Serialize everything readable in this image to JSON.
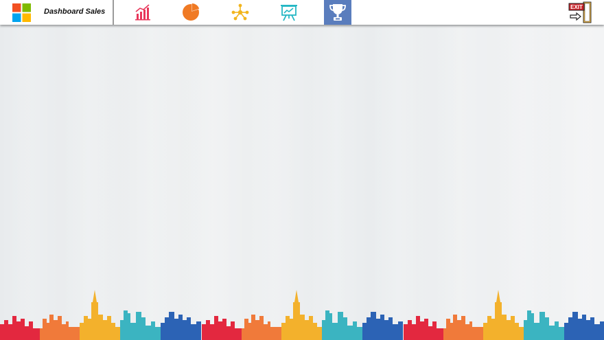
{
  "header": {
    "title": "Dashboard Sales",
    "nav": [
      {
        "icon": "bar-chart-icon",
        "color": "#e8365a"
      },
      {
        "icon": "pie-chart-icon",
        "color": "#f07a24"
      },
      {
        "icon": "network-icon",
        "color": "#f2b51e"
      },
      {
        "icon": "presentation-board-icon",
        "color": "#25b7c4"
      },
      {
        "icon": "trophy-icon",
        "color": "#ffffff",
        "active": true
      }
    ],
    "exit_sign": "EXIT"
  },
  "colors": {
    "active_tab": "#5a7dbd",
    "skyline": [
      "#e3283f",
      "#f07a3a",
      "#f3b12c",
      "#3bb4c1",
      "#2c63b5"
    ]
  }
}
